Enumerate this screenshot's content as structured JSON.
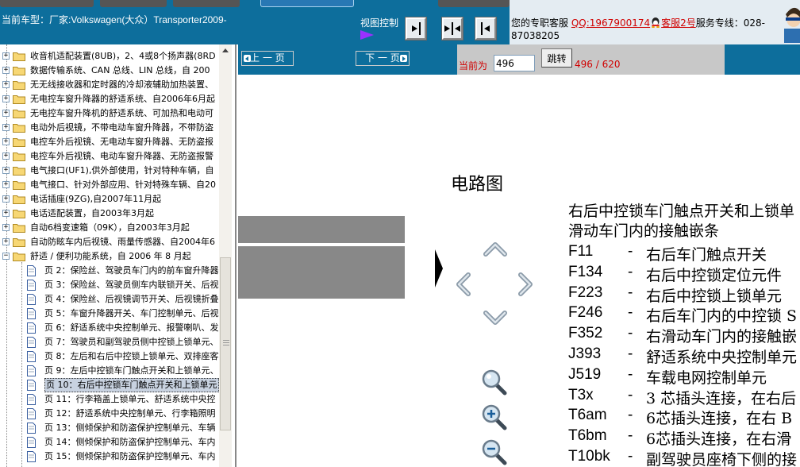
{
  "header": {
    "current_model": "当前车型：厂家:Volkswagen(大众）Transporter2009-",
    "view_control_label": "视图控制",
    "service_prefix": "您的专职客服",
    "qq_link": "QQ:1967900174",
    "kefu_link": "客服2号",
    "hotline": "服务专线：028-87038205"
  },
  "tree": {
    "items": [
      {
        "label": "收音机适配装置(8UB)，2、4或8个扬声器(8RD",
        "kind": "folder"
      },
      {
        "label": "数据传输系统、CAN 总线、LIN 总线，自 200",
        "kind": "folder"
      },
      {
        "label": "无无线接收器和定时器的冷却液辅助加热装置、",
        "kind": "folder"
      },
      {
        "label": "无电控车窗升降器的舒适系统、自2006年6月起",
        "kind": "folder"
      },
      {
        "label": "无电控车窗升降机的舒适系统、可加热和电动可",
        "kind": "folder"
      },
      {
        "label": "电动外后视镜，不带电动车窗升降器，不带防盗",
        "kind": "folder"
      },
      {
        "label": "电控车外后视镜、无电动车窗升降器、无防盗报",
        "kind": "folder"
      },
      {
        "label": "电控车外后视镜、电动车窗升降器、无防盗报警",
        "kind": "folder"
      },
      {
        "label": "电气接口(UF1),供外部使用，针对特种车辆，自",
        "kind": "folder"
      },
      {
        "label": "电气接口、针对外部应用、针对特殊车辆、自20",
        "kind": "folder"
      },
      {
        "label": "电话插座(9ZG),自2007年11月起",
        "kind": "folder"
      },
      {
        "label": "电话适配装置，自2003年3月起",
        "kind": "folder"
      },
      {
        "label": "自动6档变速箱（09K），自2003年3月起",
        "kind": "folder"
      },
      {
        "label": "自动防眩车内后视镜、雨量传感器、自2004年6",
        "kind": "folder"
      },
      {
        "label": "舒适 / 便利功能系统，自 2006 年 8 月起",
        "kind": "folder-open"
      },
      {
        "label": "页 2：保险丝、驾驶员车门内的前车窗升降器",
        "kind": "page"
      },
      {
        "label": "页 3：保险丝、驾驶员侧车内联锁开关、后视",
        "kind": "page"
      },
      {
        "label": "页 4：保险丝、后视镜调节开关、后视镜折叠",
        "kind": "page"
      },
      {
        "label": "页 5：车窗升降器开关、车门控制单元、后视",
        "kind": "page"
      },
      {
        "label": "页 6：舒适系统中央控制单元、报警喇叭、发",
        "kind": "page"
      },
      {
        "label": "页 7：驾驶员和副驾驶员侧中控锁上锁单元、",
        "kind": "page"
      },
      {
        "label": "页 8：左后和右后中控锁上锁单元、双排座客",
        "kind": "page"
      },
      {
        "label": "页 9：左后中控锁车门触点开关和上锁单元、",
        "kind": "page"
      },
      {
        "label": "页 10：右后中控锁车门触点开关和上锁单元",
        "kind": "page"
      },
      {
        "label": "页 11：行李箱盖上锁单元、舒适系统中央控",
        "kind": "page"
      },
      {
        "label": "页 12：舒适系统中央控制单元、行李箱照明",
        "kind": "page"
      },
      {
        "label": "页 13：侧倾保护和防盗保护控制单元、车辆",
        "kind": "page"
      },
      {
        "label": "页 14：侧倾保护和防盗保护控制单元、车内",
        "kind": "page"
      },
      {
        "label": "页 15：侧倾保护和防盗保护控制单元、车内",
        "kind": "page"
      }
    ],
    "selected_index": 23
  },
  "pager": {
    "prev_label": "上 一 页",
    "next_label": "下 一 页",
    "current_label": "当前为",
    "current_value": "496",
    "jump_label": "跳转",
    "page_count": "496 / 620"
  },
  "document": {
    "title": "电路图",
    "heading_line1": "右后中控锁车门触点开关和上锁单",
    "heading_line2": "滑动车门内的接触嵌条",
    "legend": [
      {
        "code": "F11",
        "desc": "右后车门触点开关"
      },
      {
        "code": "F134",
        "desc": "右后中控锁定位元件"
      },
      {
        "code": "F223",
        "desc": "右后中控锁上锁单元"
      },
      {
        "code": "F246",
        "desc": "右后车门内的中控锁 S"
      },
      {
        "code": "F352",
        "desc": "右滑动车门内的接触嵌"
      },
      {
        "code": "J393",
        "desc": "舒适系统中央控制单元"
      },
      {
        "code": "J519",
        "desc": "车载电网控制单元"
      },
      {
        "code": "T3x",
        "desc": "3 芯插头连接，在右后"
      },
      {
        "code": "T6am",
        "desc": "6芯插头连接，在右 B"
      },
      {
        "code": "T6bm",
        "desc": "6芯插头连接，在右滑"
      },
      {
        "code": "T10bk",
        "desc": "副驾驶员座椅下侧的接"
      }
    ],
    "dash": "-"
  },
  "colors": {
    "header_blue": "#0d6e9c",
    "link_red": "#d00000",
    "panel_grey": "#c8c8c8"
  }
}
